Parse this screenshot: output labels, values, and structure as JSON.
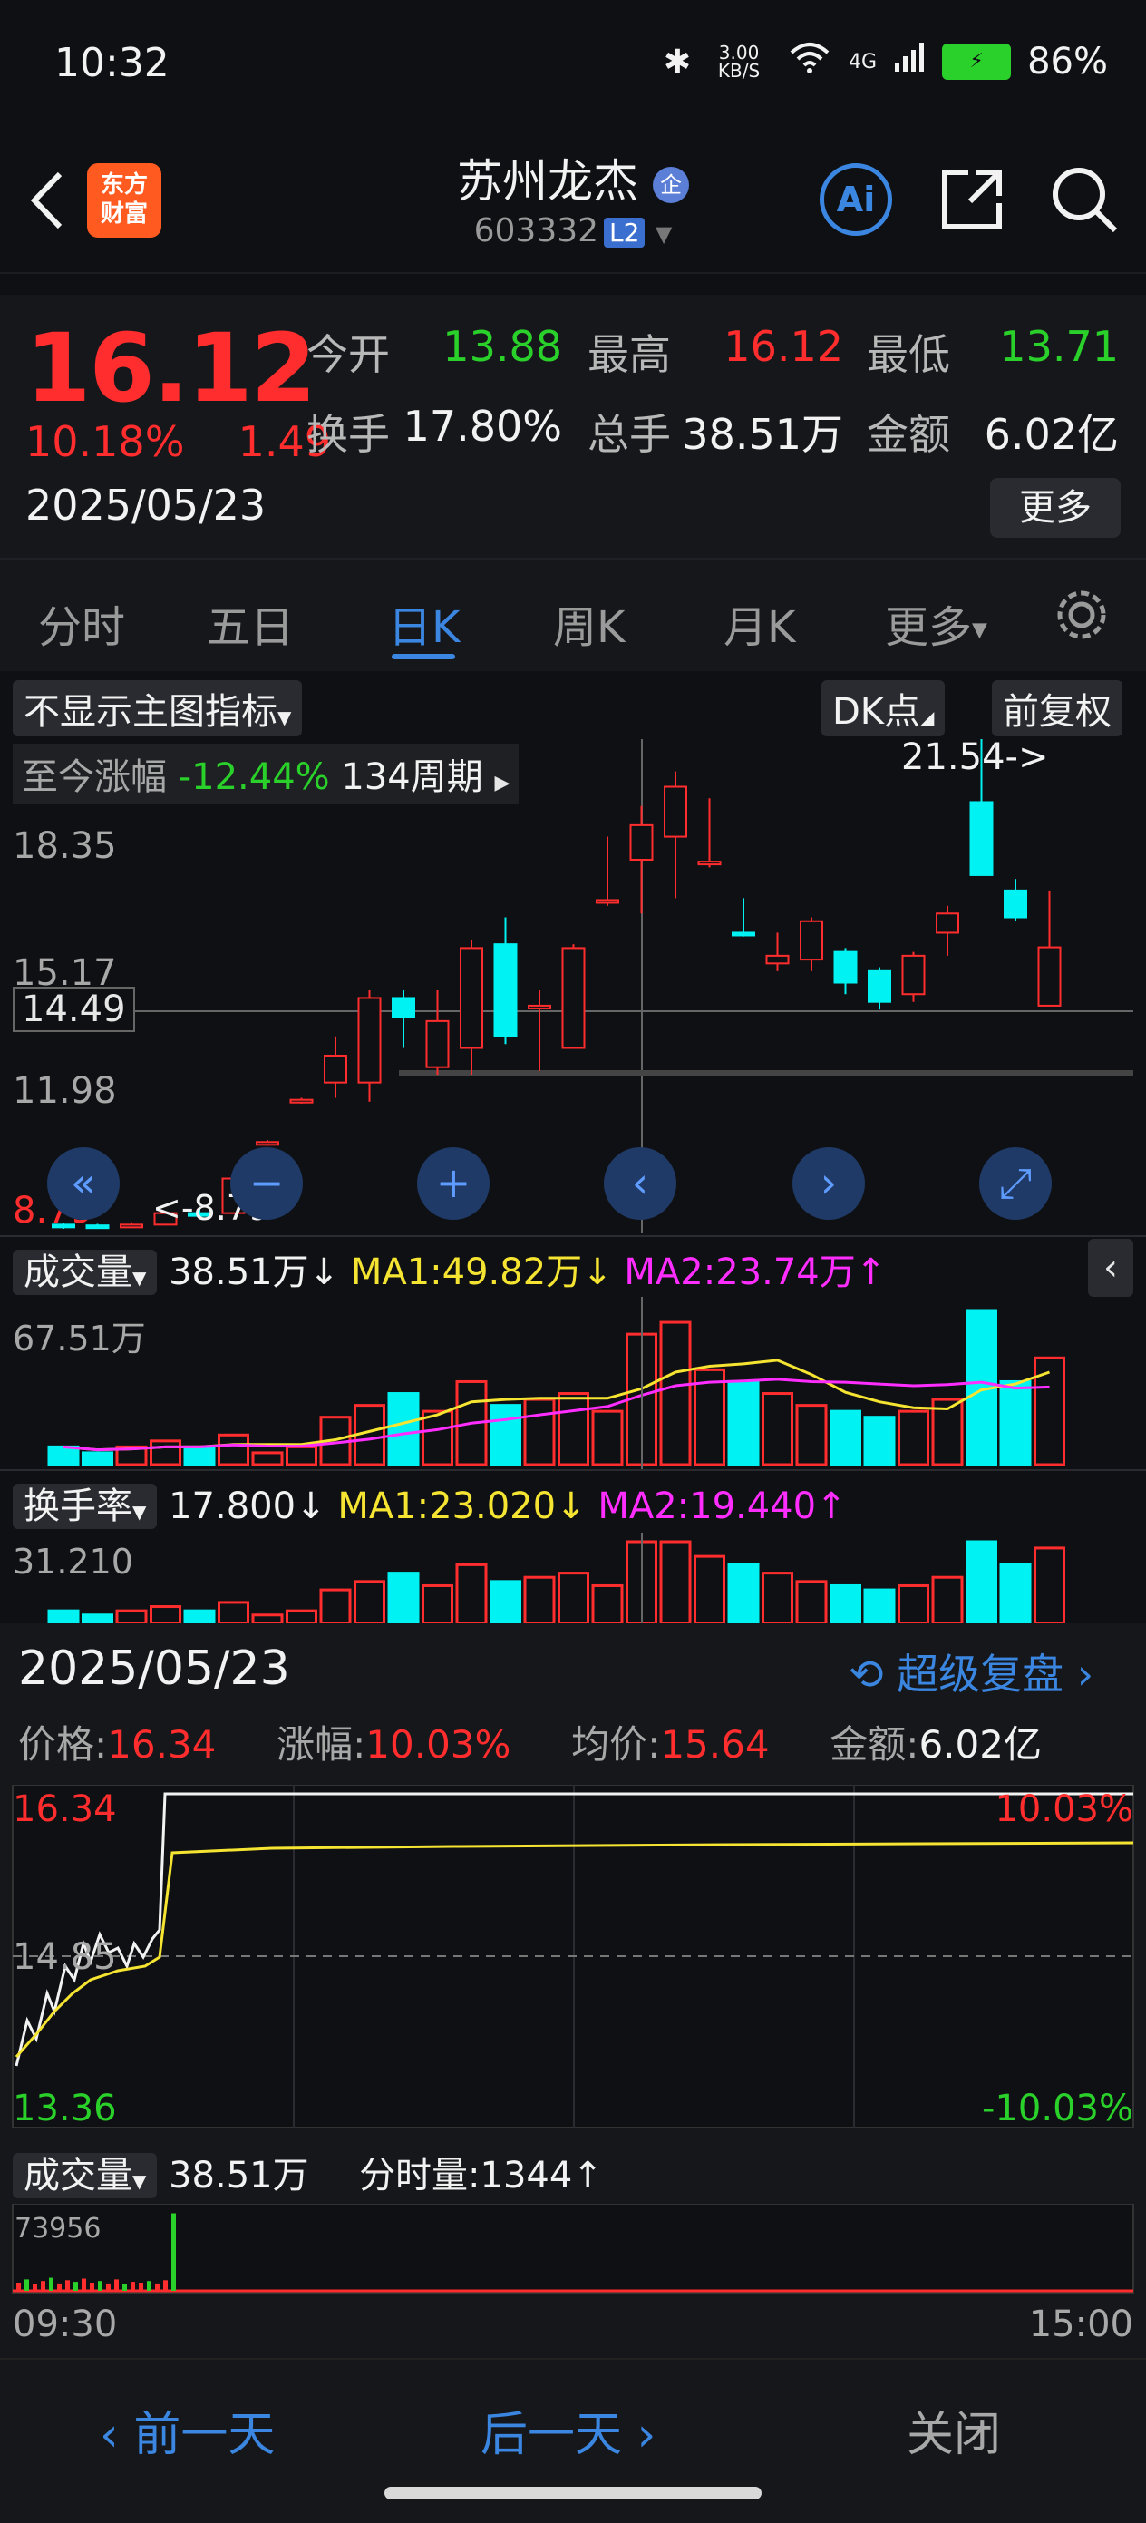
{
  "status_bar": {
    "time": "10:32",
    "net_speed": "3.00 KB/S",
    "signal": "4G",
    "battery": "86%"
  },
  "nav": {
    "stock_name": "苏州龙杰",
    "badge": "企",
    "stock_code": "603332",
    "level": "L2",
    "ai_label": "Ai"
  },
  "quote": {
    "price": "16.12",
    "change_pct": "10.18%",
    "change_amt": "1.49",
    "date": "2025/05/23",
    "open_label": "今开",
    "open": "13.88",
    "high_label": "最高",
    "high": "16.12",
    "low_label": "最低",
    "low": "13.71",
    "turnover_label": "换手",
    "turnover": "17.80%",
    "volume_label": "总手",
    "volume": "38.51万",
    "amount_label": "金额",
    "amount": "6.02亿",
    "more": "更多"
  },
  "tabs": [
    "分时",
    "五日",
    "日K",
    "周K",
    "月K",
    "更多"
  ],
  "tabs_active": "日K",
  "kchart": {
    "indicator_select": "不显示主图指标",
    "dk_label": "DK点",
    "adjust_label": "前复权",
    "range_label": "至今涨幅",
    "range_pct": "-12.44%",
    "range_period": "134周期",
    "max_marker": "21.54->",
    "min_marker": "<-8.79",
    "cursor_price": "14.49",
    "y_ticks": [
      "18.35",
      "15.17",
      "11.98",
      "8.79"
    ],
    "volume_label": "成交量",
    "volume_value": "38.51万↓",
    "vol_ma1": "MA1:49.82万↓",
    "vol_ma2": "MA2:23.74万↑",
    "vol_top": "67.51万",
    "turnover_label": "换手率",
    "turnover_value": "17.800↓",
    "to_ma1": "MA1:23.020↓",
    "to_ma2": "MA2:19.440↑",
    "to_top": "31.210"
  },
  "chart_data": {
    "type": "candlestick",
    "note": "",
    "candles": [
      {
        "o": 8.9,
        "c": 8.85,
        "h": 8.95,
        "l": 8.79
      },
      {
        "o": 8.88,
        "c": 8.84,
        "h": 8.92,
        "l": 8.8
      },
      {
        "o": 8.85,
        "c": 8.9,
        "h": 8.96,
        "l": 8.82
      },
      {
        "o": 8.9,
        "c": 9.2,
        "h": 9.25,
        "l": 8.88
      },
      {
        "o": 9.2,
        "c": 9.15,
        "h": 9.3,
        "l": 9.1
      },
      {
        "o": 9.2,
        "c": 10.1,
        "h": 10.12,
        "l": 9.2
      },
      {
        "o": 11.0,
        "c": 11.05,
        "h": 11.1,
        "l": 10.95
      },
      {
        "o": 12.1,
        "c": 12.15,
        "h": 12.2,
        "l": 12.05
      },
      {
        "o": 12.6,
        "c": 13.3,
        "h": 13.8,
        "l": 12.2
      },
      {
        "o": 12.6,
        "c": 14.8,
        "h": 15.0,
        "l": 12.1
      },
      {
        "o": 14.8,
        "c": 14.3,
        "h": 15.0,
        "l": 13.5
      },
      {
        "o": 13.0,
        "c": 14.2,
        "h": 15.0,
        "l": 12.8
      },
      {
        "o": 13.5,
        "c": 16.1,
        "h": 16.3,
        "l": 12.8
      },
      {
        "o": 16.2,
        "c": 13.8,
        "h": 16.9,
        "l": 13.6
      },
      {
        "o": 14.6,
        "c": 14.6,
        "h": 15.0,
        "l": 12.9
      },
      {
        "o": 13.5,
        "c": 16.1,
        "h": 16.2,
        "l": 13.5
      },
      {
        "o": 17.3,
        "c": 17.35,
        "h": 19.0,
        "l": 17.2
      },
      {
        "o": 18.4,
        "c": 19.3,
        "h": 19.8,
        "l": 17.0
      },
      {
        "o": 19.0,
        "c": 20.3,
        "h": 20.7,
        "l": 17.4
      },
      {
        "o": 18.3,
        "c": 18.35,
        "h": 20.0,
        "l": 18.2
      },
      {
        "o": 16.5,
        "c": 16.45,
        "h": 17.4,
        "l": 16.4
      },
      {
        "o": 15.7,
        "c": 15.9,
        "h": 16.5,
        "l": 15.5
      },
      {
        "o": 15.8,
        "c": 16.8,
        "h": 16.9,
        "l": 15.5
      },
      {
        "o": 16.0,
        "c": 15.2,
        "h": 16.1,
        "l": 14.9
      },
      {
        "o": 15.5,
        "c": 14.7,
        "h": 15.6,
        "l": 14.5
      },
      {
        "o": 14.9,
        "c": 15.9,
        "h": 16.0,
        "l": 14.7
      },
      {
        "o": 16.5,
        "c": 17.0,
        "h": 17.2,
        "l": 15.9
      },
      {
        "o": 19.9,
        "c": 18.0,
        "h": 21.54,
        "l": 18.0
      },
      {
        "o": 17.6,
        "c": 16.9,
        "h": 17.9,
        "l": 16.8
      },
      {
        "o": 14.6,
        "c": 16.12,
        "h": 17.6,
        "l": 15.6
      }
    ],
    "ylim": [
      8.79,
      21.54
    ]
  },
  "intraday": {
    "date": "2025/05/23",
    "replay": "超级复盘",
    "price_label": "价格:",
    "price": "16.34",
    "chg_label": "涨幅:",
    "chg": "10.03%",
    "avg_label": "均价:",
    "avg": "15.64",
    "amt_label": "金额:",
    "amt": "6.02亿",
    "top_left": "16.34",
    "mid_left": "14.85",
    "bottom_left": "13.36",
    "top_right": "10.03%",
    "bottom_right": "-10.03%",
    "vol_label": "成交量",
    "vol_value": "38.51万",
    "tick_label": "分时量:1344↑",
    "vol_top": "73956",
    "time_start": "09:30",
    "time_end": "15:00"
  },
  "bottom_nav": {
    "prev": "前一天",
    "next": "后一天",
    "close": "关闭"
  },
  "colors": {
    "up": "#ff2d2d",
    "down": "#00f2f2",
    "accent": "#3a86e0",
    "ma1": "#f5e431",
    "ma2": "#ff2dff"
  }
}
